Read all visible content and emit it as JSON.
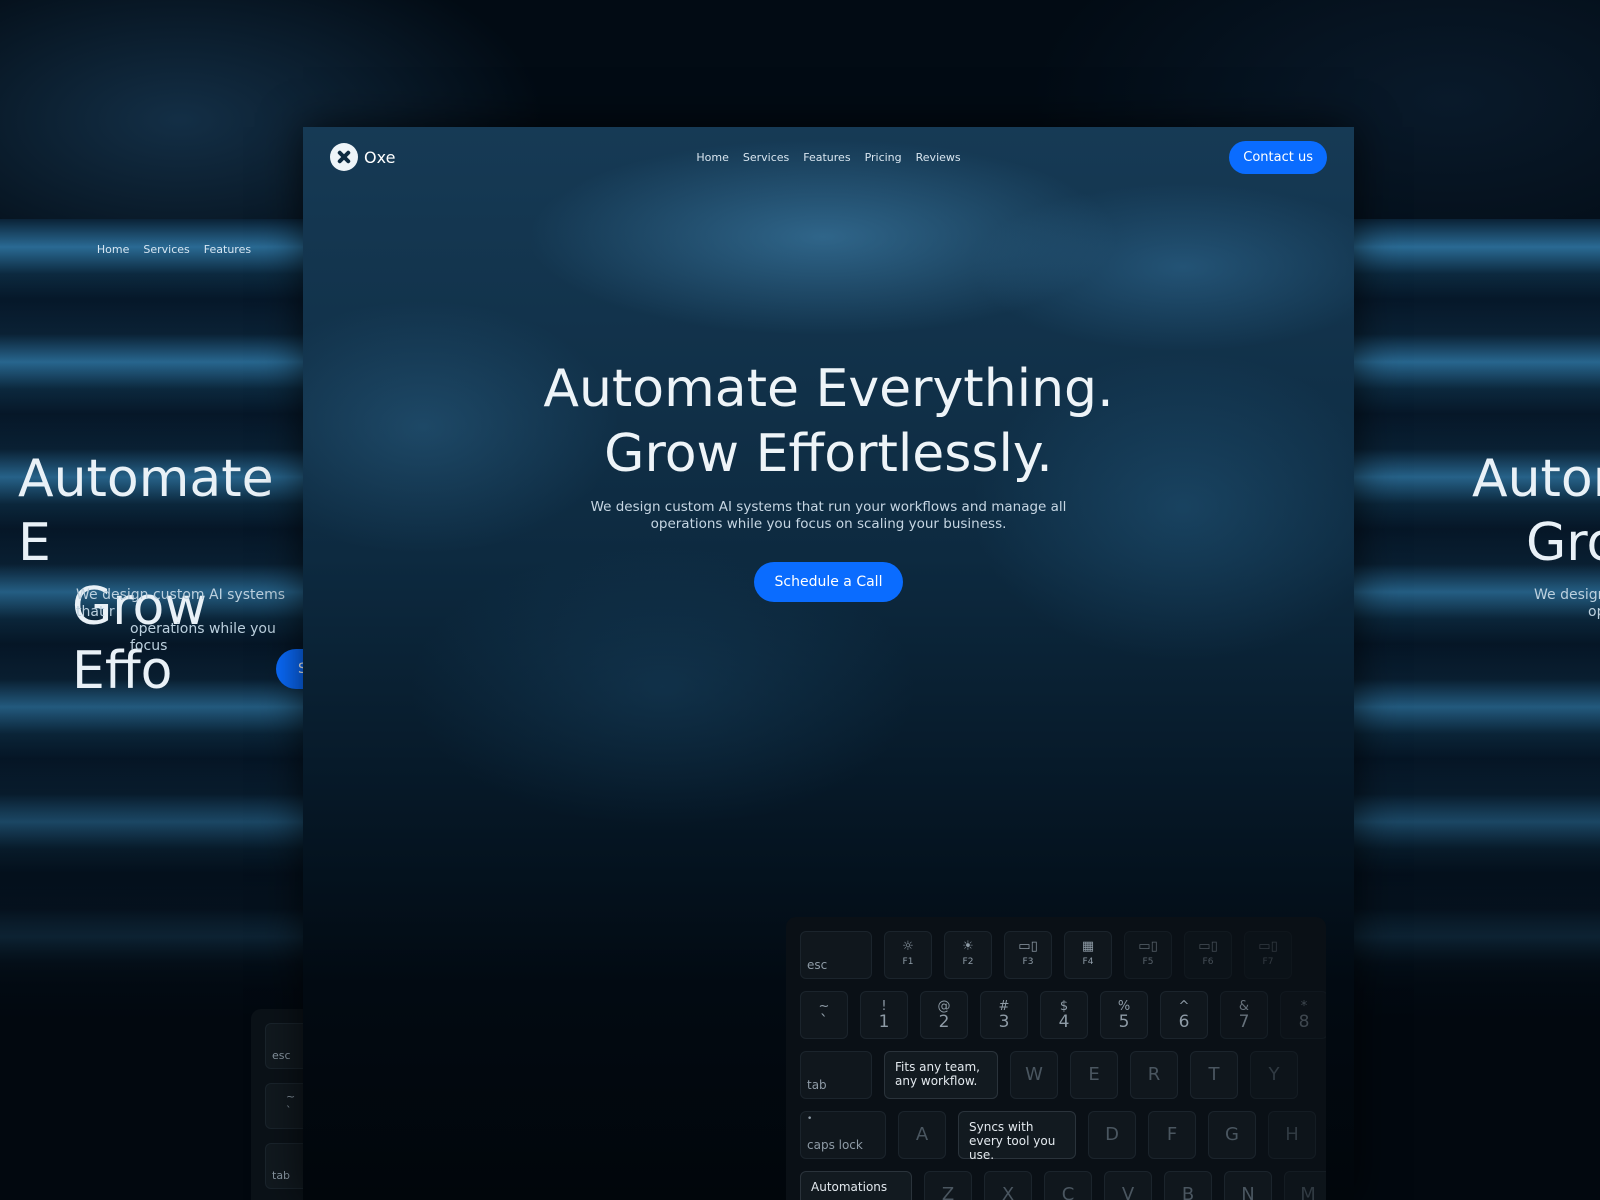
{
  "brand": {
    "name": "Oxe"
  },
  "nav": {
    "items": [
      "Home",
      "Services",
      "Features",
      "Pricing",
      "Reviews"
    ],
    "contact_label": "Contact us"
  },
  "hero": {
    "line1": "Automate Everything.",
    "line2": "Grow Effortlessly.",
    "subtitle_line1": "We design custom AI systems that run your workflows and manage all",
    "subtitle_line2": "operations while you focus on scaling your business.",
    "cta_label": "Schedule a Call"
  },
  "left_preview": {
    "nav": [
      "Home",
      "Services",
      "Features"
    ],
    "line1": "Automate E",
    "line2": "Grow Effo",
    "sub1": "We design custom AI systems that r",
    "sub2": "operations while you focus",
    "cta": "Schedule",
    "keys": [
      "esc",
      "~",
      "`",
      "tab"
    ]
  },
  "right_preview": {
    "line1": "Autor",
    "line2": "Gro",
    "sub1": "We design",
    "sub2": "op"
  },
  "keyboard": {
    "esc": "esc",
    "fn": [
      {
        "icon": "☼",
        "label": "F1"
      },
      {
        "icon": "☀",
        "label": "F2"
      },
      {
        "icon": "▭▯",
        "label": "F3"
      },
      {
        "icon": "▦",
        "label": "F4"
      },
      {
        "icon": "▭▯",
        "label": "F5"
      },
      {
        "icon": "▭▯",
        "label": "F6"
      },
      {
        "icon": "▭▯",
        "label": "F7"
      }
    ],
    "number_row": [
      {
        "top": "~",
        "bot": "`"
      },
      {
        "top": "!",
        "bot": "1"
      },
      {
        "top": "@",
        "bot": "2"
      },
      {
        "top": "#",
        "bot": "3"
      },
      {
        "top": "$",
        "bot": "4"
      },
      {
        "top": "%",
        "bot": "5"
      },
      {
        "top": "^",
        "bot": "6"
      },
      {
        "top": "&",
        "bot": "7"
      },
      {
        "top": "*",
        "bot": "8"
      }
    ],
    "tab": "tab",
    "caps": "caps lock",
    "row_q": [
      "W",
      "E",
      "R",
      "T",
      "Y"
    ],
    "row_a": [
      "A",
      "D",
      "F",
      "G",
      "H"
    ],
    "row_z": [
      "Z",
      "X",
      "C",
      "V",
      "B",
      "N",
      "M"
    ],
    "callouts": {
      "team": "Fits any team, any workflow.",
      "sync": "Syncs with every tool you use.",
      "auto": "Automations"
    }
  }
}
